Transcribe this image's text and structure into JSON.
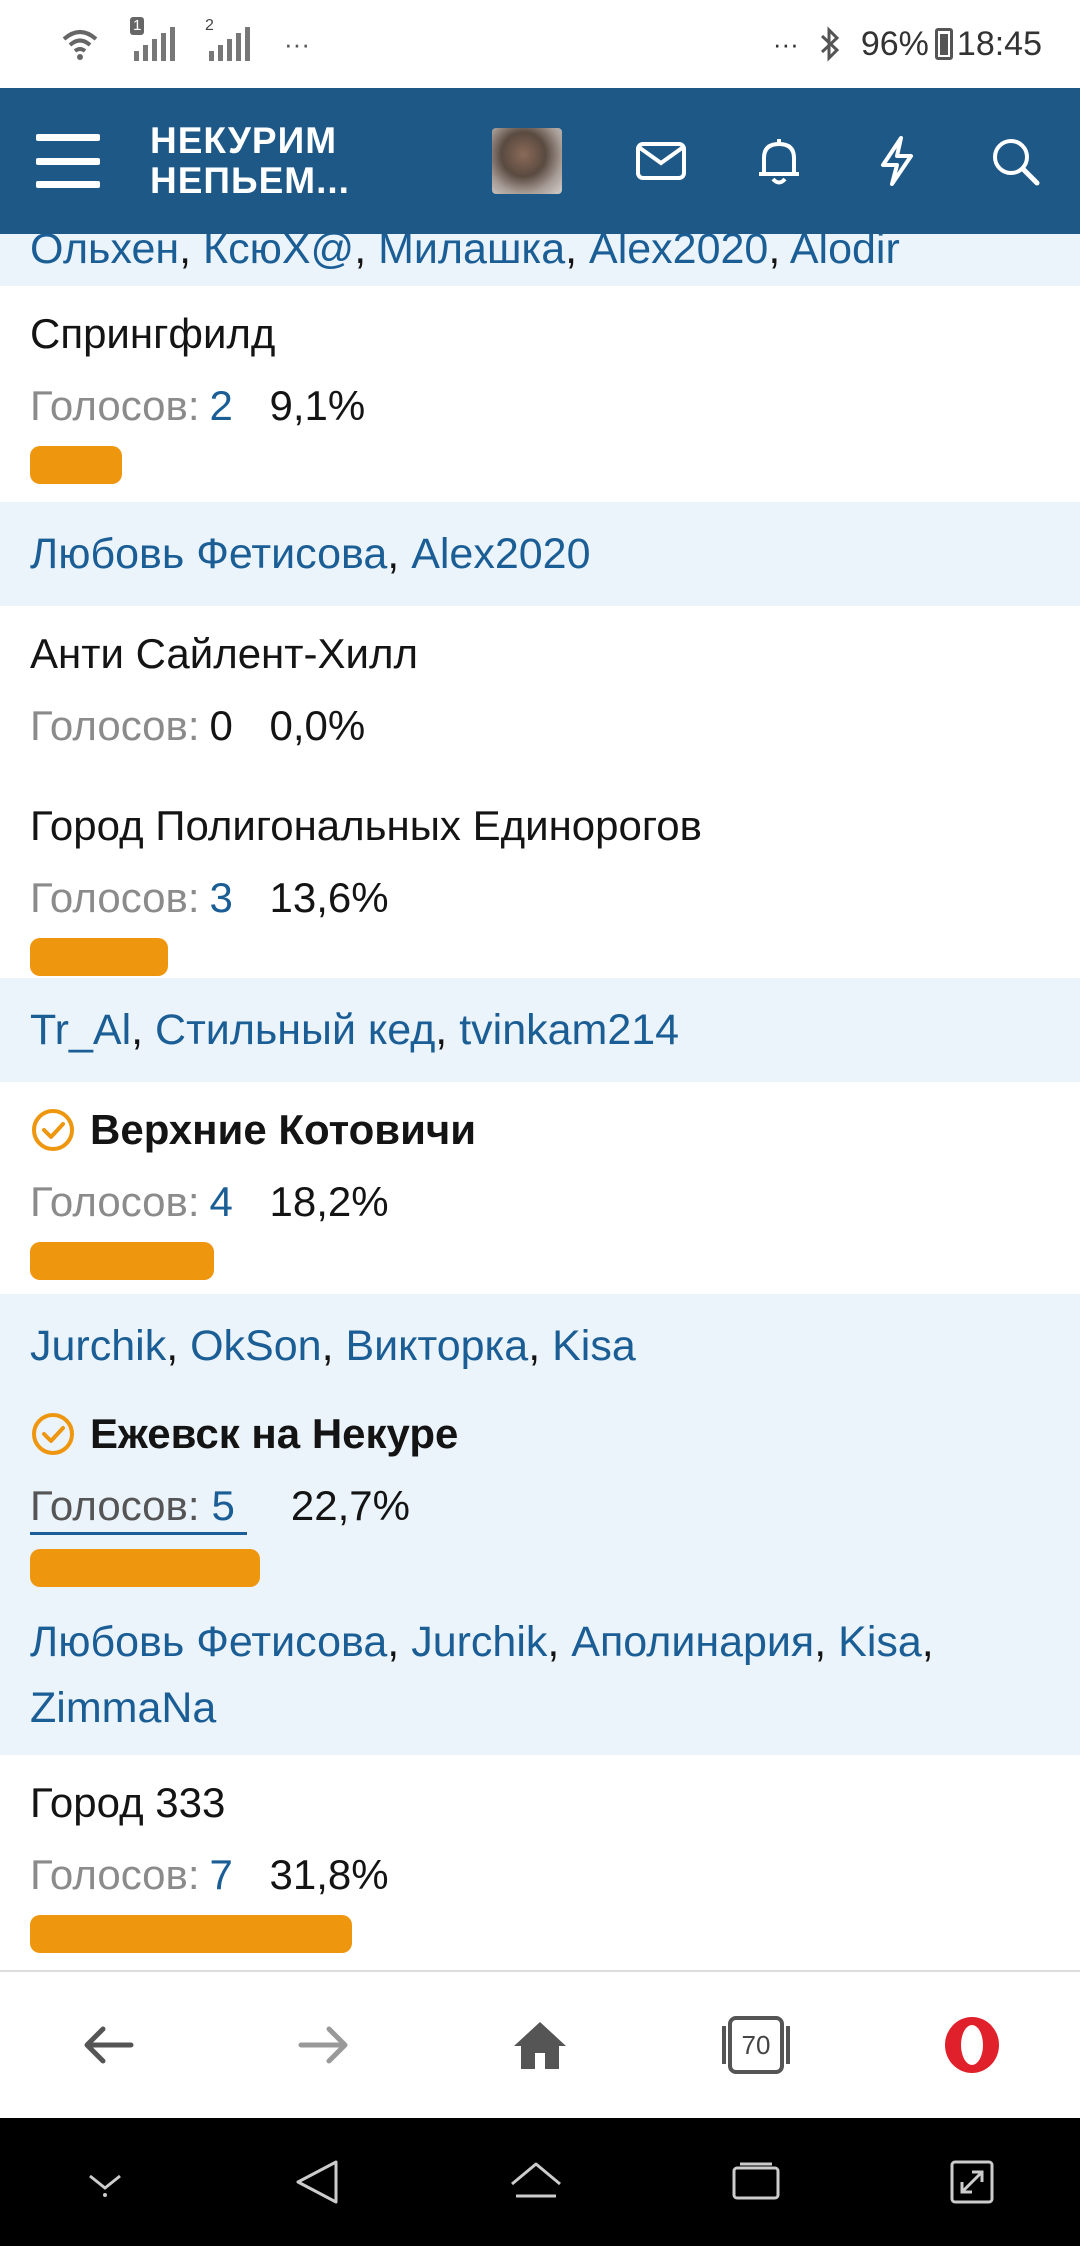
{
  "status": {
    "sim1": "1",
    "sim2": "2",
    "left_more": "···",
    "right_more": "···",
    "battery": "96%",
    "time": "18:45"
  },
  "header": {
    "logo_line1": "НЕКУРИМ",
    "logo_line2": "НЕПЬЕМ..."
  },
  "poll": {
    "label_votes": "Голосов:",
    "top_voters": [
      "Ольхен",
      "КсюХ@",
      "Милашка",
      "Alex2020",
      "Alodir"
    ],
    "options": [
      {
        "title": "Спрингфилд",
        "votes": "2",
        "percent": "9,1%",
        "fraction": 0.091,
        "voted": false,
        "voters": [
          "Любовь Фетисова",
          "Alex2020"
        ]
      },
      {
        "title": "Анти Сайлент-Хилл",
        "votes": "0",
        "percent": "0,0%",
        "fraction": 0.0,
        "voted": false,
        "voters": []
      },
      {
        "title": "Город Полигональных Единорогов",
        "votes": "3",
        "percent": "13,6%",
        "fraction": 0.136,
        "voted": false,
        "voters": [
          "Tr_Al",
          "Стильный кед",
          "tvinkam214"
        ]
      },
      {
        "title": "Верхние Котовичи",
        "votes": "4",
        "percent": "18,2%",
        "fraction": 0.182,
        "voted": true,
        "voters": [
          "Jurchik",
          "OkSon",
          "Викторка",
          "Kisa"
        ]
      },
      {
        "title": "Ежевск на Некуре",
        "votes": "5",
        "percent": "22,7%",
        "fraction": 0.227,
        "voted": true,
        "voters": [
          "Любовь Фетисова",
          "Jurchik",
          "Аполинария",
          "Kisa",
          "ZimmaNa"
        ]
      },
      {
        "title": "Город 333",
        "votes": "7",
        "percent": "31,8%",
        "fraction": 0.318,
        "voted": false,
        "voters": []
      }
    ]
  },
  "bottom_nav": {
    "tabs_count": "70"
  },
  "colors": {
    "header_bg": "#1d5887",
    "link": "#1a5e95",
    "bar": "#ef960f",
    "voters_bg": "#ebf3fb",
    "opera_red": "#e0202a"
  }
}
